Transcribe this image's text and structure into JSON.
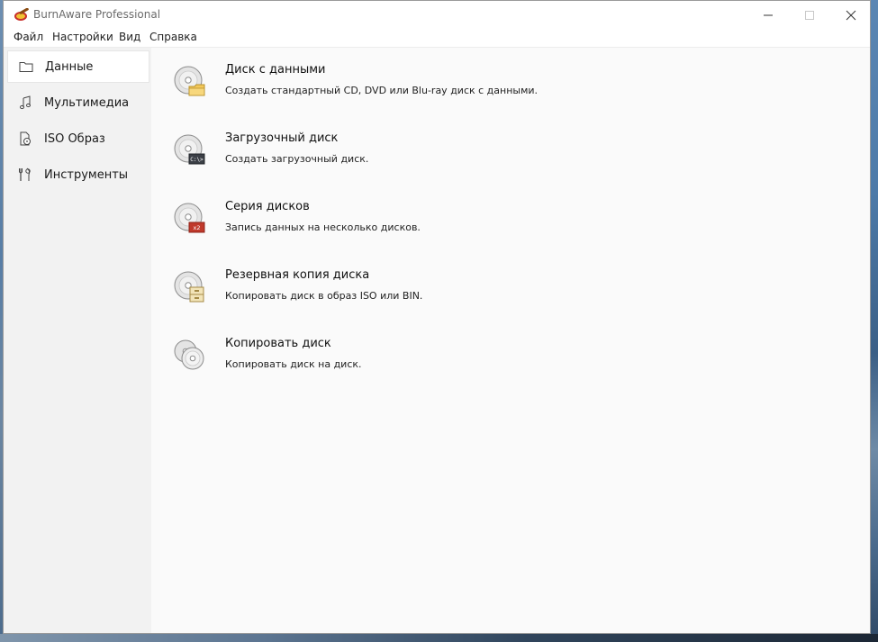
{
  "window": {
    "title": "BurnAware Professional"
  },
  "menu": {
    "items": [
      "Файл",
      "Настройки",
      "Вид",
      "Справка"
    ]
  },
  "sidebar": {
    "items": [
      {
        "label": "Данные",
        "icon": "folder-icon",
        "active": true
      },
      {
        "label": "Мультимедиа",
        "icon": "music-note-icon",
        "active": false
      },
      {
        "label": "ISO Образ",
        "icon": "iso-file-icon",
        "active": false
      },
      {
        "label": "Инструменты",
        "icon": "tools-icon",
        "active": false
      }
    ]
  },
  "tasks": [
    {
      "title": "Диск с данными",
      "desc": "Создать стандартный CD, DVD или Blu-ray диск с данными.",
      "icon": "data-disc-icon"
    },
    {
      "title": "Загрузочный диск",
      "desc": "Создать загрузочный диск.",
      "icon": "boot-disc-icon",
      "badge": "C:\\>"
    },
    {
      "title": "Серия дисков",
      "desc": "Запись данных на несколько дисков.",
      "icon": "disc-span-icon",
      "badge": "x2"
    },
    {
      "title": "Резервная копия диска",
      "desc": "Копировать диск в образ ISO или BIN.",
      "icon": "disc-backup-icon"
    },
    {
      "title": "Копировать диск",
      "desc": "Копировать диск на диск.",
      "icon": "copy-disc-icon"
    }
  ],
  "colors": {
    "sidebar_bg": "#f2f2f2",
    "main_bg": "#fafafa",
    "folder_yellow": "#f3c85a",
    "span_red": "#c0392b"
  }
}
